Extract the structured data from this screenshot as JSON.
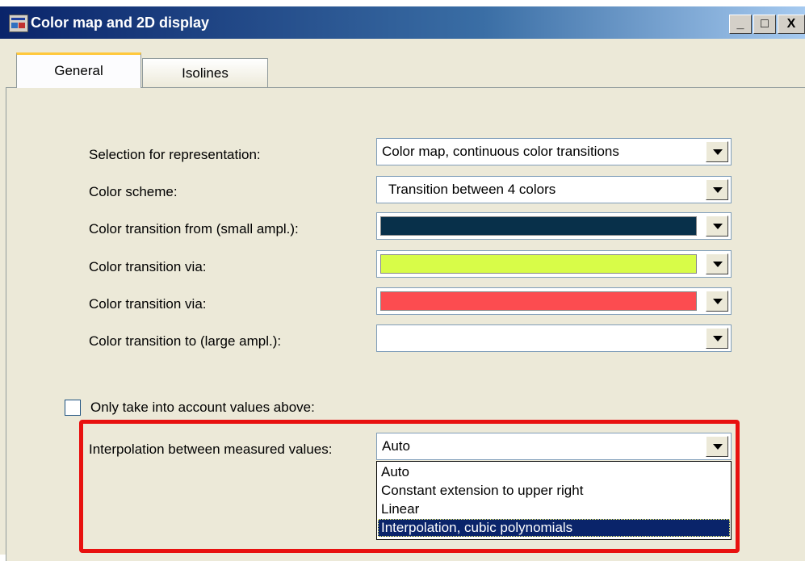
{
  "window": {
    "title": "Color map and 2D display",
    "controls": {
      "minimize": "_",
      "maximize": "□",
      "close": "X"
    }
  },
  "tabs": [
    {
      "label": "General",
      "active": true
    },
    {
      "label": "Isolines",
      "active": false
    }
  ],
  "form": {
    "representation_label": "Selection for representation:",
    "representation_value": "Color map, continuous color transitions",
    "scheme_label": "Color scheme:",
    "scheme_value": "Transition between 4 colors",
    "from_label": "Color transition from (small ampl.):",
    "from_color": "#08304a",
    "via1_label": "Color transition via:",
    "via1_color": "#d8fc48",
    "via2_label": "Color transition via:",
    "via2_color": "#fc4c50",
    "to_label": "Color transition to (large ampl.):",
    "to_color": "#ffffff",
    "only_values_label": "Only take into account values above:",
    "only_values_checked": false,
    "interpolation_label": "Interpolation between measured values:",
    "interpolation_value": "Auto",
    "interpolation_options": [
      "Auto",
      "Constant extension to upper right",
      "Linear",
      "Interpolation, cubic polynomials"
    ],
    "interpolation_highlighted_index": 3
  },
  "colors": {
    "highlight_box": "#e8110f",
    "title_bar": "#0a246a",
    "dialog_bg": "#ece9d8"
  }
}
